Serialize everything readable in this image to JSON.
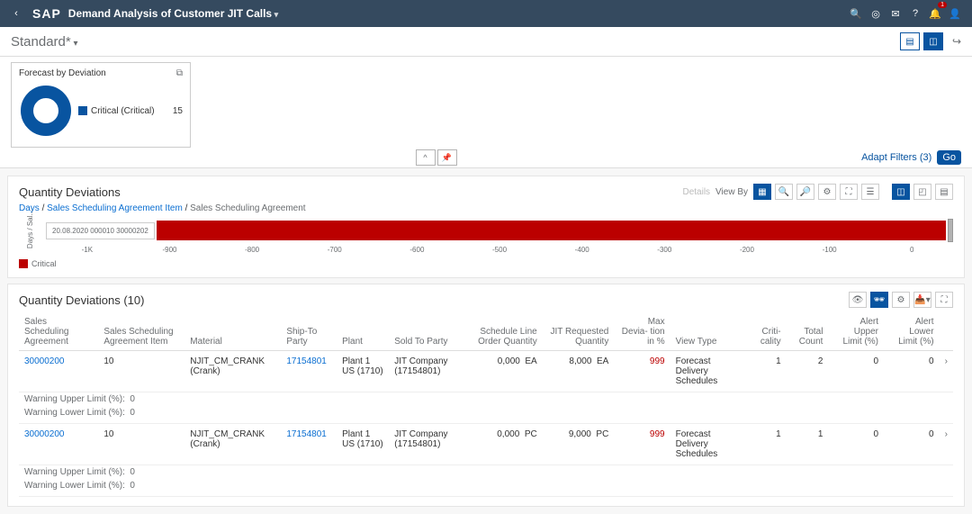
{
  "shell": {
    "title": "Demand Analysis of Customer JIT Calls",
    "logo": "SAP",
    "notification_count": "1"
  },
  "variant": {
    "name": "Standard*"
  },
  "card": {
    "title": "Forecast by Deviation",
    "legend_label": "Critical (Critical)",
    "legend_value": "15"
  },
  "filters": {
    "adapt_label": "Adapt Filters (3)",
    "go_label": "Go"
  },
  "chart_section": {
    "title": "Quantity Deviations",
    "details_label": "Details",
    "viewby_label": "View By",
    "breadcrumb": [
      "Days",
      "Sales Scheduling Agreement Item",
      "Sales Scheduling Agreement"
    ],
    "ylabel": "Days / Sal...",
    "tooltip": "20.08.2020   000010   30000202",
    "legend": "Critical"
  },
  "chart_data": {
    "type": "bar",
    "orientation": "horizontal",
    "title": "Quantity Deviations",
    "xlabel": "",
    "ylabel": "Days / Sales Scheduling Agreement Item / Sales Scheduling Agreement",
    "xlim": [
      -1100,
      0
    ],
    "x_ticks": [
      "-1K",
      "-900",
      "-800",
      "-700",
      "-600",
      "-500",
      "-400",
      "-300",
      "-200",
      "-100",
      "0"
    ],
    "categories": [
      "20.08.2020 / 000010 / 30000202"
    ],
    "series": [
      {
        "name": "Critical",
        "color": "#bb0000",
        "values": [
          -999
        ]
      }
    ]
  },
  "table": {
    "title": "Quantity Deviations (10)",
    "columns": {
      "c1": "Sales Scheduling Agreement",
      "c2": "Sales Scheduling Agreement Item",
      "c3": "Material",
      "c4": "Ship-To Party",
      "c5": "Plant",
      "c6": "Sold To Party",
      "c7": "Schedule Line Order Quantity",
      "c8": "JIT Requested Quantity",
      "c9": "Max Devia-\ntion in %",
      "c10": "View Type",
      "c11": "Criti-\ncality",
      "c12": "Total Count",
      "c13": "Alert Upper Limit (%)",
      "c14": "Alert Lower Limit (%)"
    },
    "warn_upper_label": "Warning Upper Limit (%):",
    "warn_lower_label": "Warning Lower Limit (%):",
    "rows": [
      {
        "agreement": "30000200",
        "item": "10",
        "material": "NJIT_CM_CRANK (Crank)",
        "shipto": "17154801",
        "plant": "Plant 1 US (1710)",
        "soldto": "JIT Company (17154801)",
        "slq": "0,000",
        "slq_u": "EA",
        "jit": "8,000",
        "jit_u": "EA",
        "dev": "999",
        "viewtype": "Forecast Delivery Schedules",
        "crit": "1",
        "count": "2",
        "upper": "0",
        "lower": "0",
        "warn_upper": "0",
        "warn_lower": "0"
      },
      {
        "agreement": "30000200",
        "item": "10",
        "material": "NJIT_CM_CRANK (Crank)",
        "shipto": "17154801",
        "plant": "Plant 1 US (1710)",
        "soldto": "JIT Company (17154801)",
        "slq": "0,000",
        "slq_u": "PC",
        "jit": "9,000",
        "jit_u": "PC",
        "dev": "999",
        "viewtype": "Forecast Delivery Schedules",
        "crit": "1",
        "count": "1",
        "upper": "0",
        "lower": "0",
        "warn_upper": "0",
        "warn_lower": "0"
      }
    ]
  }
}
